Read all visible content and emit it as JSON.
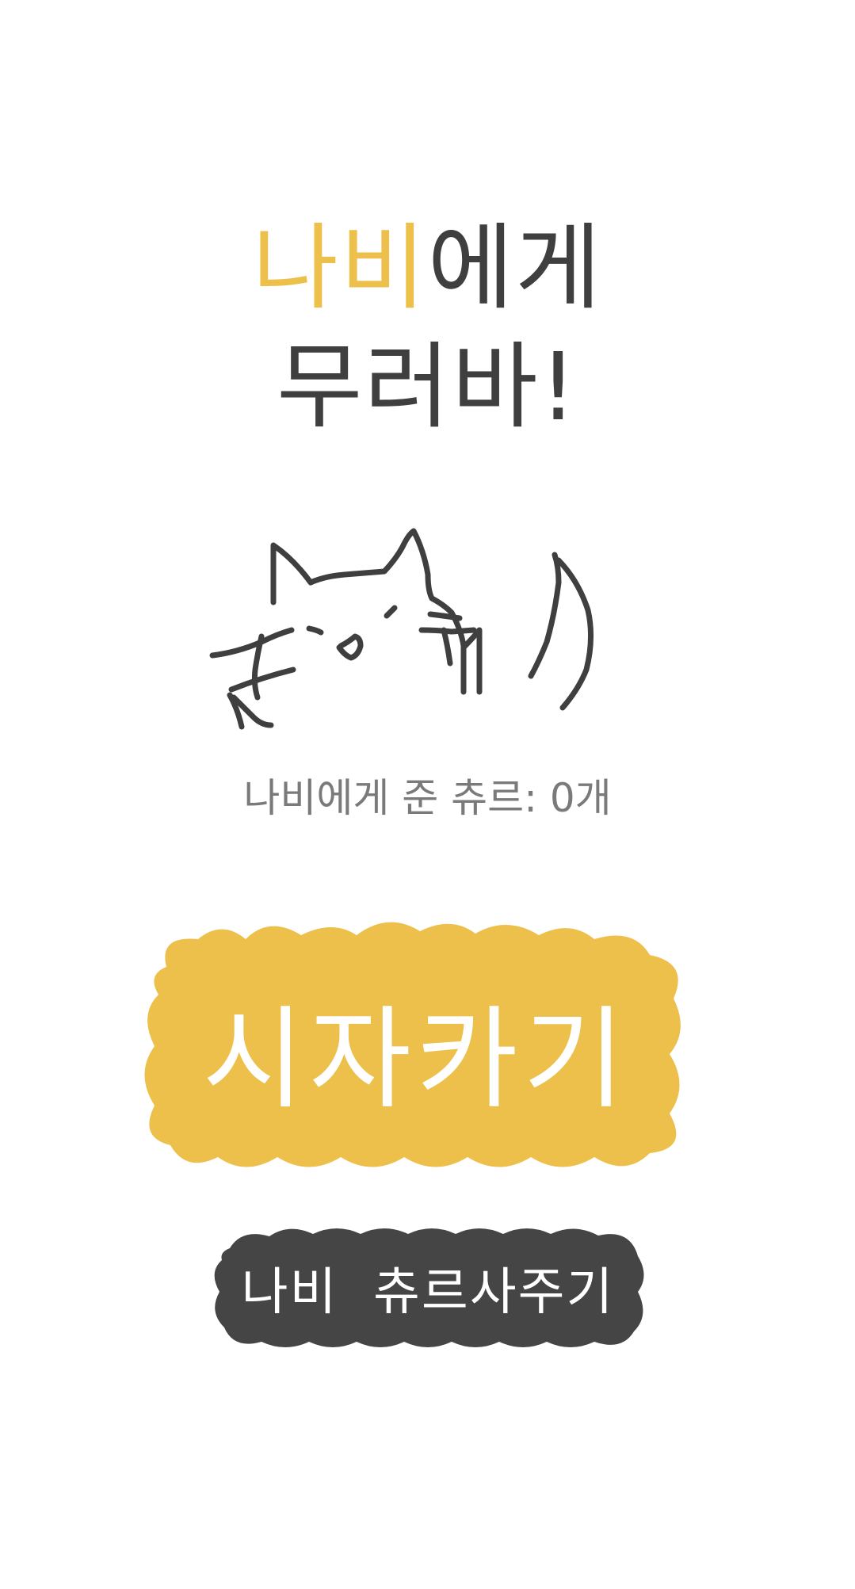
{
  "title": {
    "line1_accent": "나비",
    "line1_rest": "에게",
    "line2": "무러바!"
  },
  "status": {
    "treat_count_text": "나비에게 준 츄르: 0개"
  },
  "buttons": {
    "start_label": "시자카기",
    "buy_label": "나비  츄르사주기"
  },
  "colors": {
    "accent": "#ecc04a",
    "text_dark": "#3f3f3f",
    "text_muted": "#7a7a7a",
    "button_dark": "#454545",
    "button_text": "#ffffff"
  }
}
